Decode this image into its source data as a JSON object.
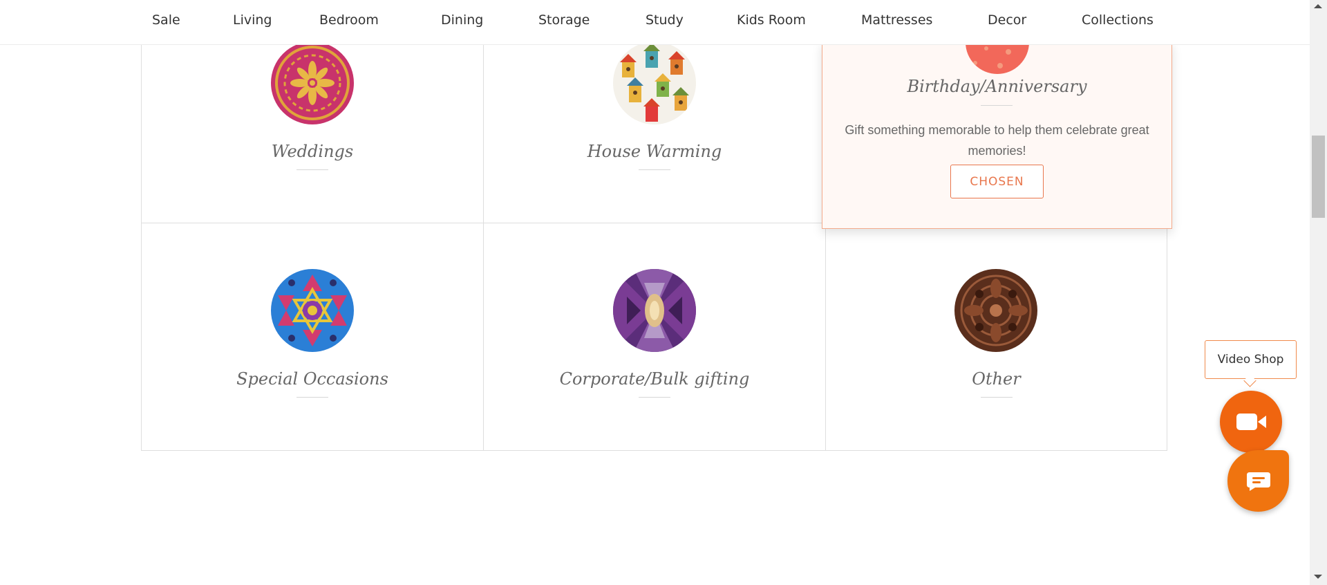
{
  "nav": {
    "items": [
      "Sale",
      "Living",
      "Bedroom",
      "Dining",
      "Storage",
      "Study",
      "Kids Room",
      "Mattresses",
      "Decor",
      "Collections"
    ]
  },
  "occasions": {
    "weddings": "Weddings",
    "house_warming": "House Warming",
    "birthday": "Birthday/Anniversary",
    "special": "Special Occasions",
    "corporate": "Corporate/Bulk gifting",
    "other": "Other"
  },
  "chosen_card": {
    "description": "Gift something memorable to help them celebrate great memories!",
    "button_label": "CHOSEN"
  },
  "widgets": {
    "video_shop_label": "Video Shop",
    "video_icon": "video-camera-icon",
    "chat_icon": "chat-bubble-icon"
  },
  "colors": {
    "accent": "#f0650f",
    "chosen_border": "#f3a98a",
    "chosen_bg": "#fff8f5"
  }
}
